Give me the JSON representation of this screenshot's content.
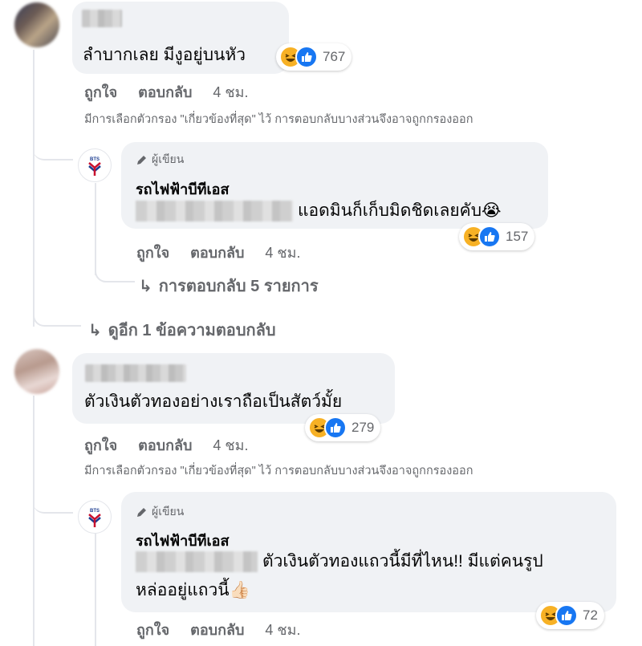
{
  "comments": [
    {
      "text": "ลำบากเลย มีงูอยู่บนหัว",
      "reactions": {
        "count": "767",
        "types": [
          "haha-icon",
          "like-icon"
        ]
      },
      "actions": {
        "like": "ถูกใจ",
        "reply": "ตอบกลับ",
        "time": "4 ชม."
      },
      "filter_note": "มีการเลือกตัวกรอง \"เกี่ยวข้องที่สุด\" ไว้ การตอบกลับบางส่วนจึงอาจถูกกรองออก",
      "reply": {
        "badge": "ผู้เขียน",
        "page_name": "รถไฟฟ้าบีทีเอส",
        "text": "แอดมินก็เก็บมิดชิดเลยคับ😭",
        "reactions": {
          "count": "157"
        },
        "actions": {
          "like": "ถูกใจ",
          "reply": "ตอบกลับ",
          "time": "4 ชม."
        },
        "more_replies": "การตอบกลับ 5 รายการ"
      },
      "view_more": "ดูอีก 1 ข้อความตอบกลับ"
    },
    {
      "text": "ตัวเงินตัวทองอย่างเราถือเป็นสัตว์มั้ย",
      "reactions": {
        "count": "279"
      },
      "actions": {
        "like": "ถูกใจ",
        "reply": "ตอบกลับ",
        "time": "4 ชม."
      },
      "filter_note": "มีการเลือกตัวกรอง \"เกี่ยวข้องที่สุด\" ไว้ การตอบกลับบางส่วนจึงอาจถูกกรองออก",
      "reply": {
        "badge": "ผู้เขียน",
        "page_name": "รถไฟฟ้าบีทีเอส",
        "text_line1": "ตัวเงินตัวทองแถวนี้มีที่ไหน!! มีแต่คนรูป",
        "text_line2": "หล่ออยู่แถวนี้👍🏻",
        "reactions": {
          "count": "72"
        },
        "actions": {
          "like": "ถูกใจ",
          "reply": "ตอบกลับ",
          "time": "4 ชม."
        }
      }
    }
  ],
  "colors": {
    "bubble": "#f0f2f5",
    "secondary_text": "#65676b",
    "like_blue": "#1877f2",
    "haha_yellow": "#f7b125"
  }
}
